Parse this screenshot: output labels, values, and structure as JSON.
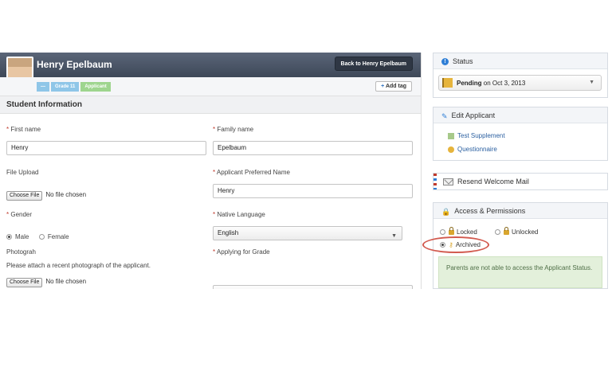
{
  "student": {
    "name": "Henry Epelbaum",
    "back_label": "Back to Henry Epelbaum",
    "tags": [
      "—",
      "Grade 11",
      "Applicant"
    ],
    "add_tag_label": "Add tag"
  },
  "section_title": "Student Information",
  "form": {
    "first_name_label": "First name",
    "first_name_value": "Henry",
    "family_name_label": "Family name",
    "family_name_value": "Epelbaum",
    "file_upload_label": "File Upload",
    "choose_file_label": "Choose File",
    "no_file_text": "No file chosen",
    "preferred_name_label": "Applicant Preferred Name",
    "preferred_name_value": "Henry",
    "gender_label": "Gender",
    "gender_options": [
      "Male",
      "Female"
    ],
    "gender_selected": "Male",
    "native_language_label": "Native Language",
    "native_language_value": "English",
    "photograph_label": "Photograh",
    "photograph_help": "Please attach a recent photograph of the applicant.",
    "applying_grade_label": "Applying for Grade"
  },
  "sidebar": {
    "status": {
      "title": "Status",
      "state": "Pending",
      "date_text": "on Oct 3, 2013"
    },
    "edit_applicant": {
      "title": "Edit Applicant",
      "links": [
        "Test Supplement",
        "Questionnaire"
      ]
    },
    "resend": {
      "title": "Resend Welcome Mail"
    },
    "access": {
      "title": "Access & Permissions",
      "options": [
        "Locked",
        "Unlocked",
        "Archived"
      ],
      "selected": "Archived",
      "note": "Parents are not able to access the Applicant Status."
    }
  },
  "colors": {
    "header_bg": "#4a5466",
    "accent_blue": "#2f7fd6",
    "note_bg": "#e3f0db",
    "highlight_ring": "#d25a4f"
  }
}
